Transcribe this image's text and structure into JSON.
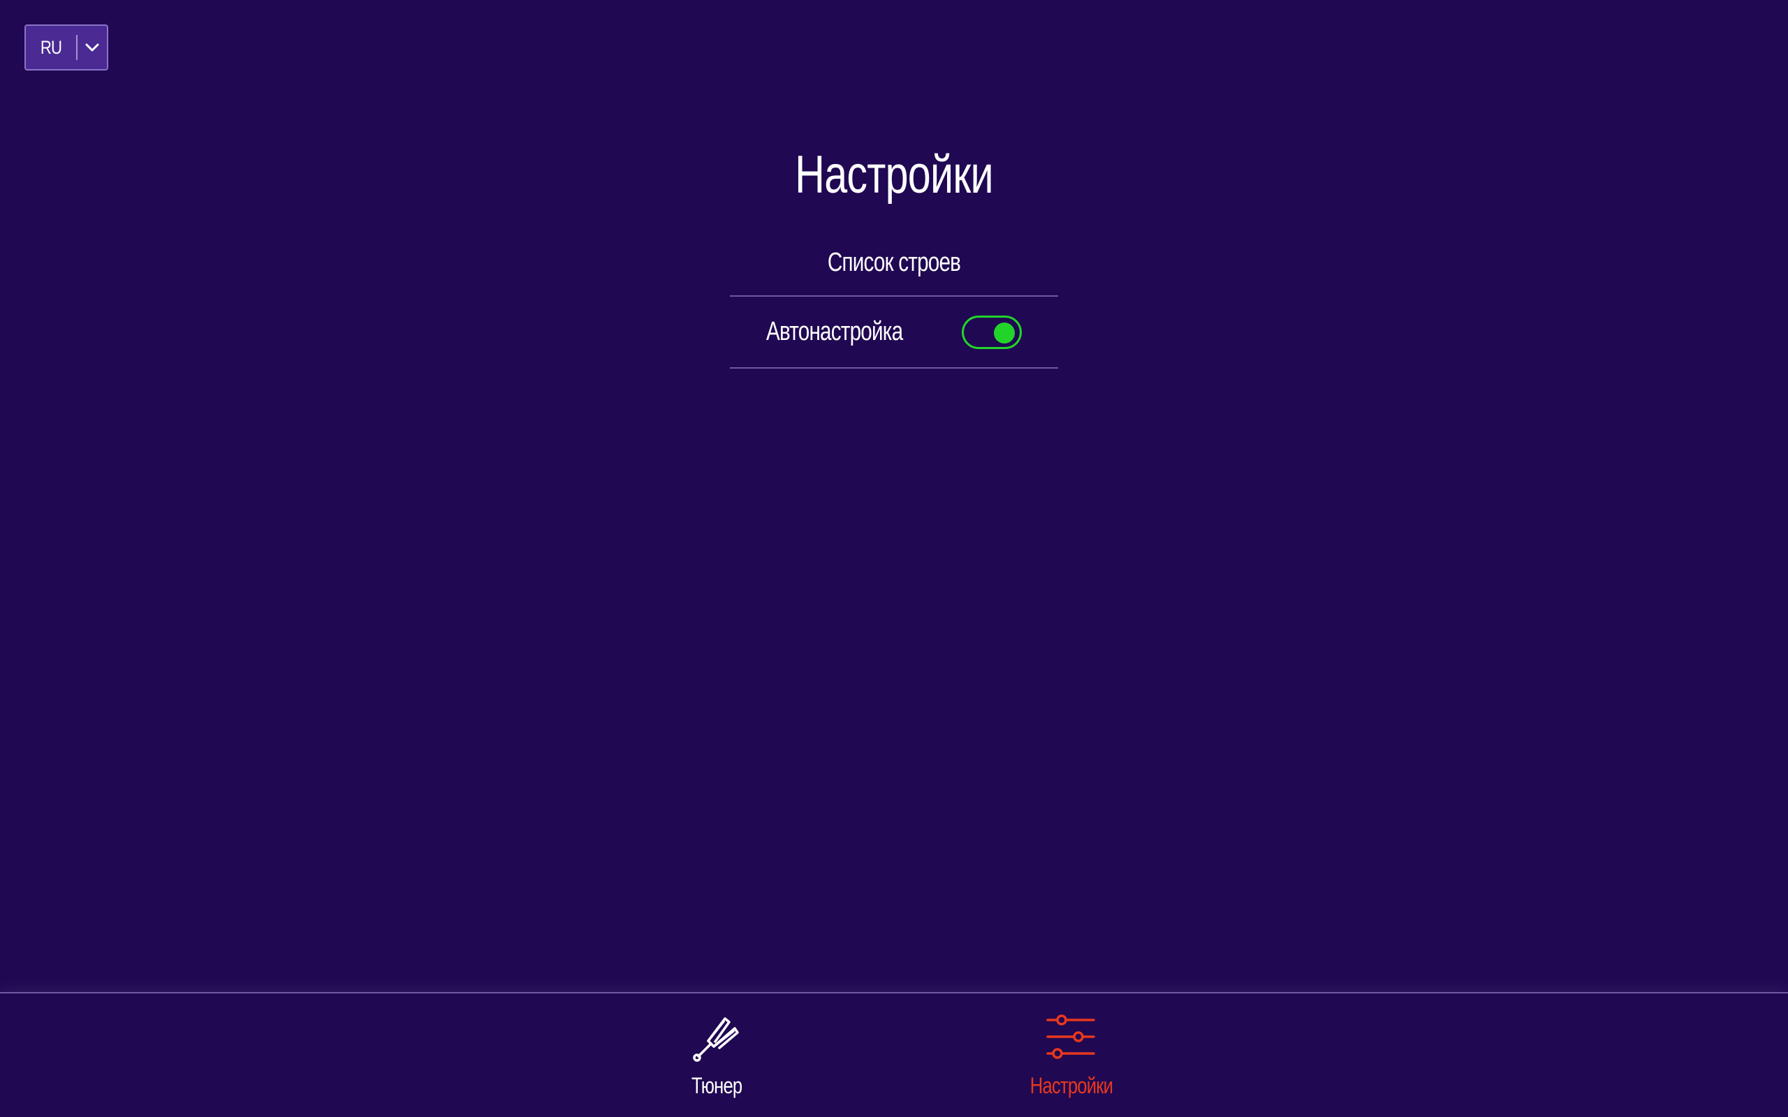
{
  "language_selector": {
    "value": "RU"
  },
  "page": {
    "title": "Настройки"
  },
  "settings": {
    "tunings_list_label": "Список строев",
    "autotune_label": "Автонастройка",
    "autotune_enabled": true
  },
  "bottom_nav": {
    "items": [
      {
        "label": "Тюнер",
        "icon": "tuning-fork-icon",
        "active": false
      },
      {
        "label": "Настройки",
        "icon": "sliders-icon",
        "active": true
      }
    ]
  },
  "colors": {
    "background": "#200852",
    "text": "#ffffff",
    "toggle_on": "#22d42a",
    "active_nav": "#e8381d",
    "selector_bg": "#4b2a93"
  }
}
